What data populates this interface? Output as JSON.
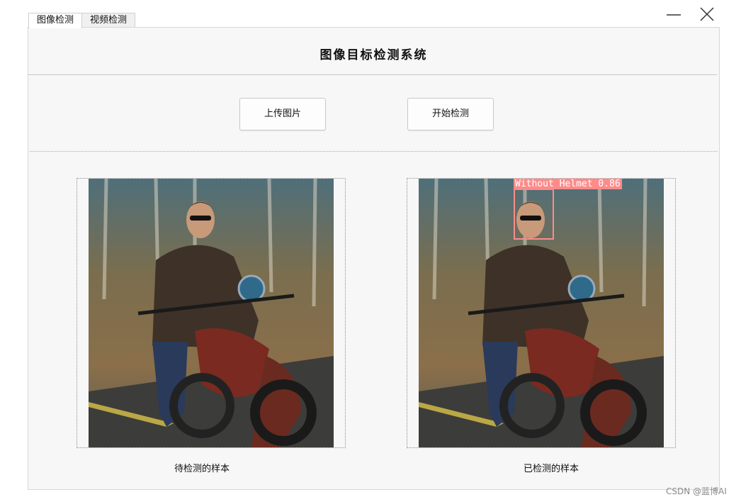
{
  "window": {
    "controls": {
      "minimize_icon": "minimize-icon",
      "close_icon": "close-icon"
    }
  },
  "tabs": [
    {
      "label": "图像检测",
      "active": true
    },
    {
      "label": "视频检测",
      "active": false
    }
  ],
  "main": {
    "title": "图像目标检测系统",
    "upload_button": "上传图片",
    "detect_button": "开始检测",
    "left_caption": "待检测的样本",
    "right_caption": "已检测的样本",
    "detection": {
      "label": "Without Helmet",
      "confidence": "0.86",
      "box_color": "#ff8a8a"
    }
  },
  "watermark": "CSDN @蓝博AI"
}
